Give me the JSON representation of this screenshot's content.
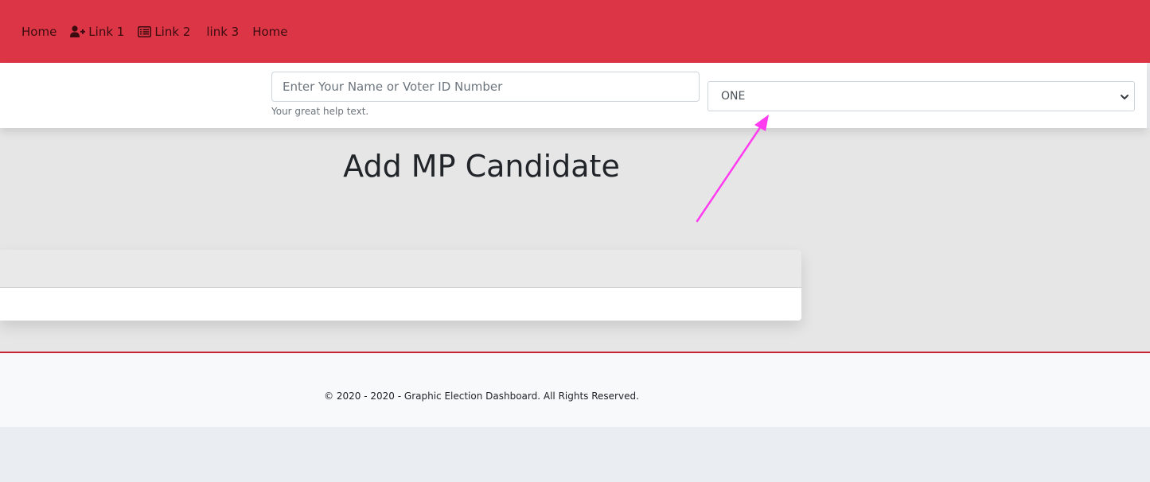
{
  "nav": {
    "items": [
      {
        "label": "Home",
        "icon": null
      },
      {
        "label": "Link 1",
        "icon": "user-plus-icon"
      },
      {
        "label": "Link 2",
        "icon": "list-icon"
      },
      {
        "label": "link 3",
        "icon": null
      },
      {
        "label": "Home",
        "icon": null
      }
    ]
  },
  "search": {
    "placeholder": "Enter Your Name or Voter ID Number",
    "value": "",
    "help_text": "Your great help text."
  },
  "select": {
    "selected": "ONE"
  },
  "main": {
    "title": "Add MP Candidate"
  },
  "footer": {
    "text": "© 2020 - 2020 - Graphic Election Dashboard. All Rights Reserved."
  },
  "colors": {
    "navbar_bg": "#dc3545",
    "nav_text": "#3a0c10",
    "arrow": "#ff3cf0",
    "footer_border": "#c82333"
  }
}
